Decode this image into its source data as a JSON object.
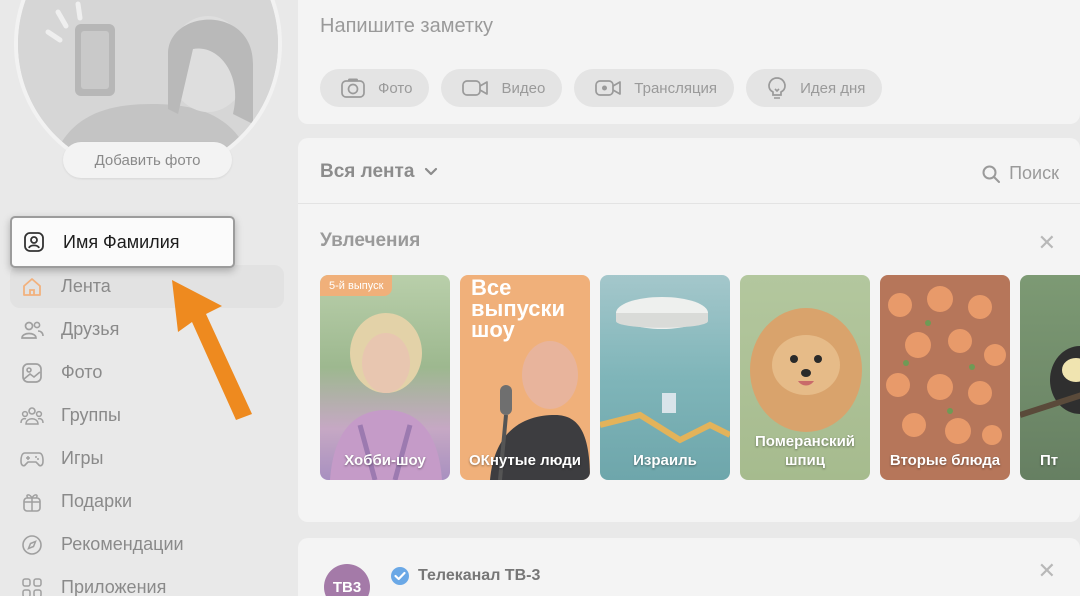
{
  "profile": {
    "add_photo_label": "Добавить фото"
  },
  "nav": {
    "items": [
      {
        "label": "Имя Фамилия",
        "icon": "user-icon"
      },
      {
        "label": "Лента",
        "icon": "home-icon"
      },
      {
        "label": "Друзья",
        "icon": "friends-icon"
      },
      {
        "label": "Фото",
        "icon": "photo-icon"
      },
      {
        "label": "Группы",
        "icon": "groups-icon"
      },
      {
        "label": "Игры",
        "icon": "gamepad-icon"
      },
      {
        "label": "Подарки",
        "icon": "gift-icon"
      },
      {
        "label": "Рекомендации",
        "icon": "compass-icon"
      },
      {
        "label": "Приложения",
        "icon": "apps-icon"
      }
    ]
  },
  "compose": {
    "placeholder": "Напишите заметку",
    "chips": [
      {
        "label": "Фото",
        "icon": "camera-icon"
      },
      {
        "label": "Видео",
        "icon": "video-icon"
      },
      {
        "label": "Трансляция",
        "icon": "broadcast-icon"
      },
      {
        "label": "Идея дня",
        "icon": "lightbulb-icon"
      }
    ]
  },
  "feed": {
    "title": "Вся лента",
    "search_label": "Поиск",
    "hobbies": {
      "title": "Увлечения",
      "cards": [
        {
          "label": "Хобби-шоу",
          "badge": "5-й выпуск"
        },
        {
          "label": "ОКнутые люди",
          "headline": "Все выпуски шоу"
        },
        {
          "label": "Израиль"
        },
        {
          "label": "Померанский шпиц"
        },
        {
          "label": "Вторые блюда"
        },
        {
          "label": "Пт"
        }
      ]
    }
  },
  "post": {
    "author": "Телеканал ТВ-3",
    "logo_text": "ТВ3"
  },
  "colors": {
    "accent_arrow": "#ee8a1f",
    "verified": "#6aa8e6"
  }
}
